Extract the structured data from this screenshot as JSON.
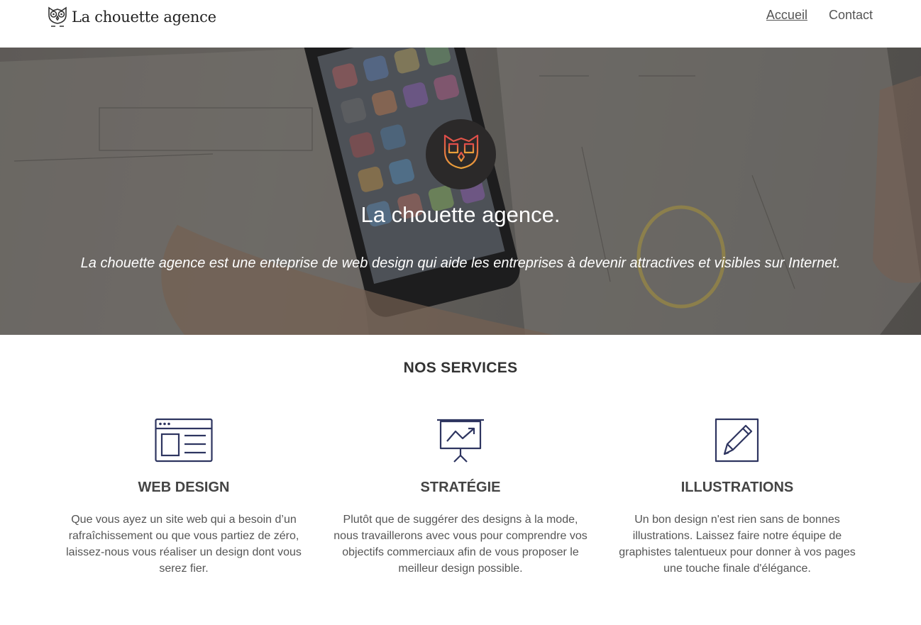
{
  "header": {
    "brand": "La chouette agence",
    "nav": [
      {
        "label": "Accueil",
        "active": true
      },
      {
        "label": "Contact",
        "active": false
      }
    ]
  },
  "hero": {
    "title": "La chouette agence.",
    "subtitle": "La chouette agence est une enteprise de web design qui aide les entreprises à devenir attractives et visibles sur Internet."
  },
  "services": {
    "title": "NOS SERVICES",
    "items": [
      {
        "icon": "browser-window-icon",
        "title": "WEB DESIGN",
        "text": "Que vous ayez un site web qui a besoin d’un rafraîchissement ou que vous partiez de zéro, laissez-nous vous réaliser un design dont vous serez fier."
      },
      {
        "icon": "presentation-chart-icon",
        "title": "STRATÉGIE",
        "text": "Plutôt que de suggérer des designs à la mode, nous travaillerons avec vous pour comprendre vos objectifs commerciaux afin de vous proposer le meilleur design possible."
      },
      {
        "icon": "pencil-square-icon",
        "title": "ILLUSTRATIONS",
        "text": "Un bon design n'est rien sans de bonnes illustrations. Laissez faire notre équipe de graphistes talentueux pour donner à vos pages une touche finale d'élégance."
      }
    ]
  },
  "colors": {
    "icon_stroke": "#2e3560",
    "hero_owl": "#e0902a",
    "badge_bg": "#2b2929"
  }
}
